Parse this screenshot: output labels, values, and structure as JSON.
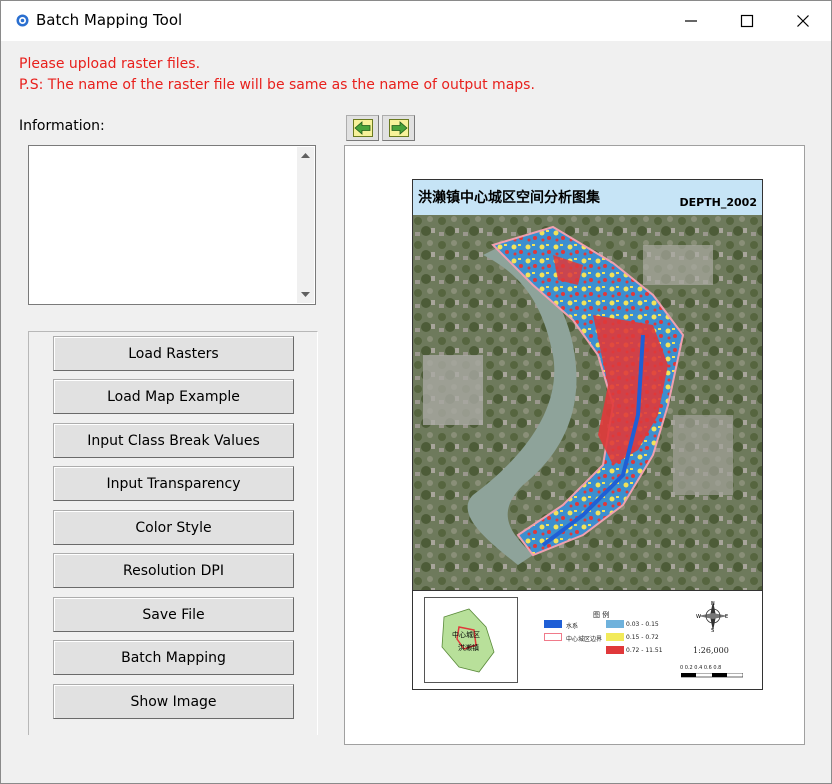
{
  "window": {
    "title": "Batch Mapping Tool"
  },
  "messages": {
    "line1": "Please upload raster files.",
    "line2": "P.S: The name of the raster file will be same as the name of output maps."
  },
  "info": {
    "label": "Information:",
    "value": ""
  },
  "buttons": [
    {
      "label": "Load Rasters"
    },
    {
      "label": "Load Map Example"
    },
    {
      "label": "Input Class Break Values"
    },
    {
      "label": "Input Transparency"
    },
    {
      "label": "Color Style"
    },
    {
      "label": "Resolution DPI"
    },
    {
      "label": "Save File"
    },
    {
      "label": "Batch Mapping"
    },
    {
      "label": "Show Image"
    }
  ],
  "nav": {
    "prev_icon": "arrow-left-icon",
    "next_icon": "arrow-right-icon"
  },
  "map": {
    "title": "洪濑镇中心城区空间分析图集",
    "subtitle": "DEPTH_2002",
    "legend_title": "图   例",
    "legend_items": [
      {
        "label": "水系",
        "color": "#1f5fd6"
      },
      {
        "label": "中心城区边界",
        "color": "#f07a8a"
      },
      {
        "label": "0.03 - 0.15",
        "color": "#6fb2dc"
      },
      {
        "label": "0.15 - 0.72",
        "color": "#f2ea5a"
      },
      {
        "label": "0.72 - 11.51",
        "color": "#e0383a"
      }
    ],
    "inset_labels": [
      "中心城区",
      "洪濑镇"
    ],
    "scale": "1:26,000",
    "scalebar_ticks": "0 0.2 0.4 0.6 0.8",
    "compass_labels": [
      "N",
      "S",
      "W",
      "E"
    ]
  },
  "colors": {
    "message": "#e8201c",
    "title_bg": "#ffffff",
    "window_bg": "#f0f0f0"
  }
}
